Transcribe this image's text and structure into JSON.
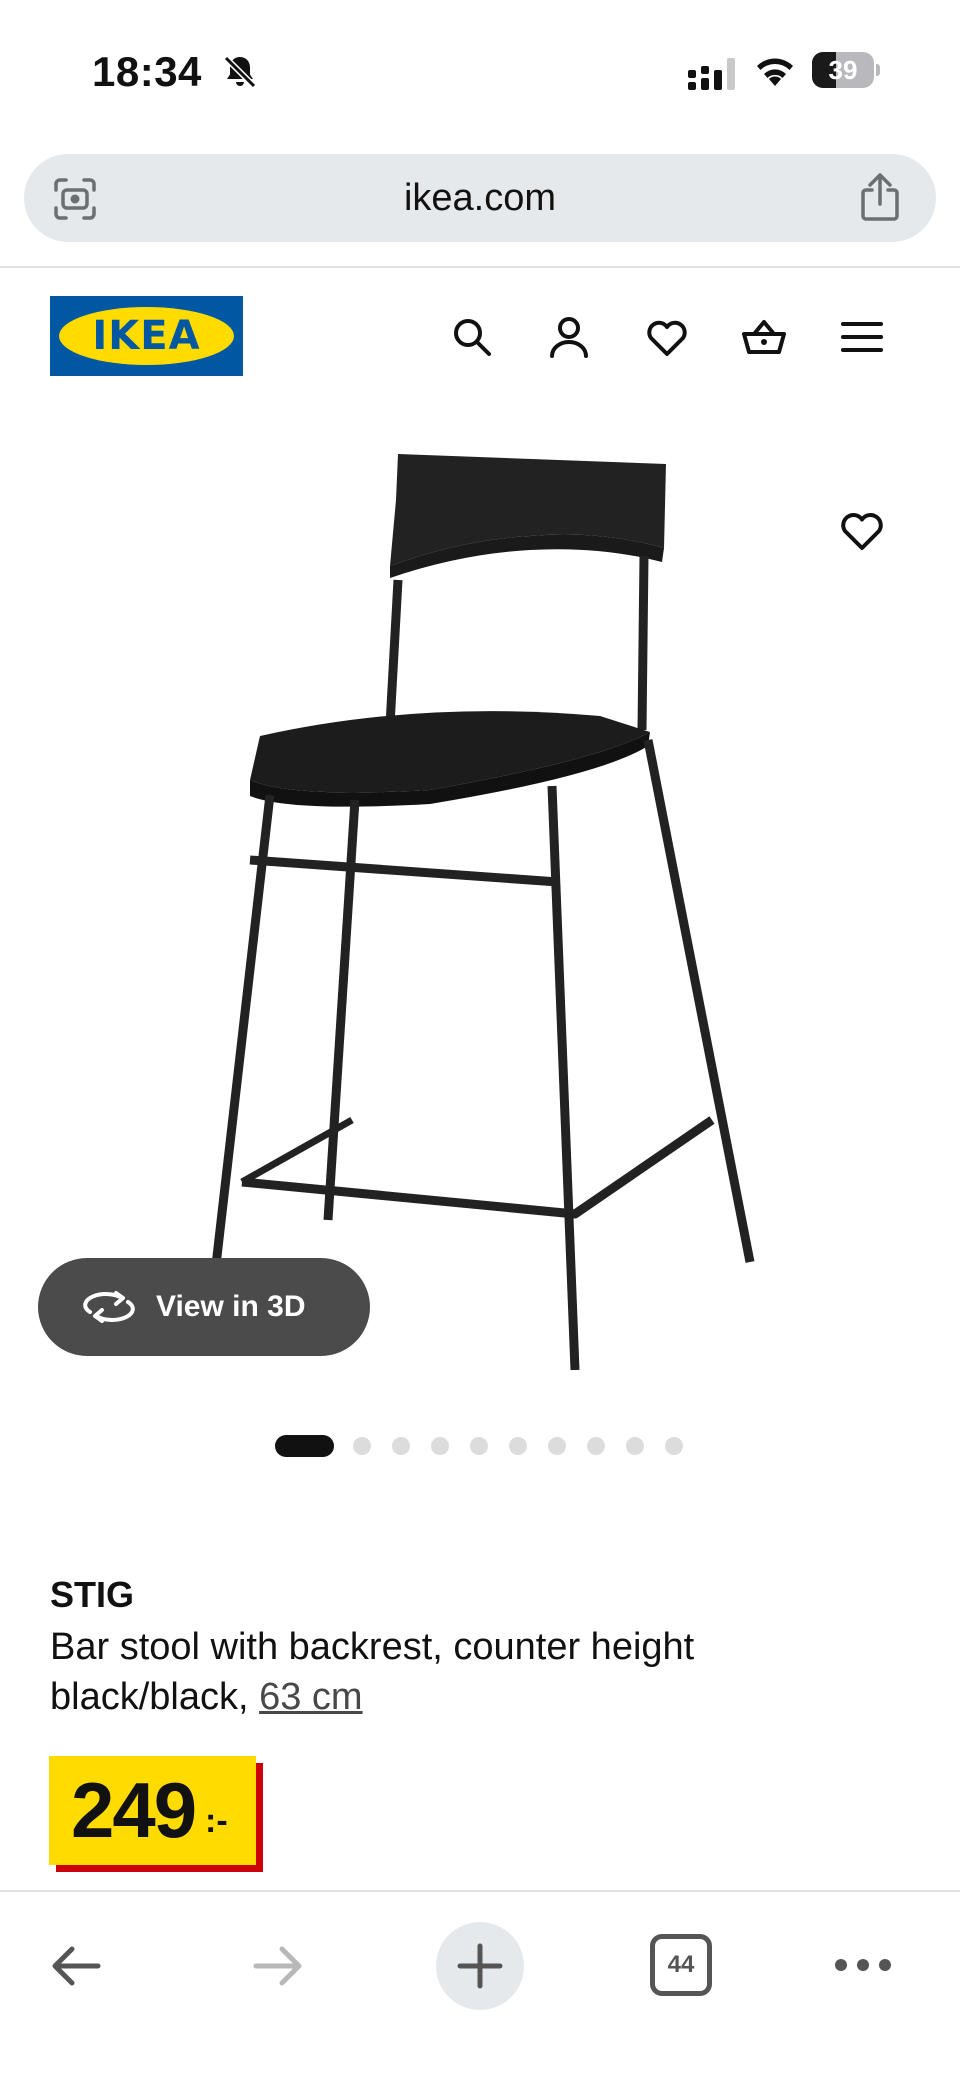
{
  "status_bar": {
    "time": "18:34",
    "battery": "39",
    "battery_level": 0.39,
    "icons": [
      "bell-slash-icon",
      "signal-icon",
      "wifi-icon",
      "battery-icon"
    ]
  },
  "browser": {
    "url": "ikea.com",
    "left_icon": "scan-icon",
    "right_icon": "share-icon"
  },
  "header": {
    "logo": "IKEA",
    "nav_icons": [
      "search-icon",
      "account-icon",
      "favourites-icon",
      "basket-icon",
      "menu-icon"
    ]
  },
  "gallery": {
    "view_3d_label": "View in 3D",
    "image_count": 10,
    "active_index": 0
  },
  "product": {
    "name": "STIG",
    "description_line1": "Bar stool with backrest, counter height",
    "description_line2": "black/black, ",
    "size": "63 cm",
    "price": "249",
    "price_suffix": ":-"
  },
  "toolbar": {
    "tab_count": "44",
    "buttons": [
      "back-icon",
      "forward-icon",
      "new-tab-icon",
      "tabs-icon",
      "more-icon"
    ]
  },
  "colors": {
    "ikea_blue": "#0058a3",
    "ikea_yellow": "#ffdb00",
    "price_red": "#cc0008"
  }
}
